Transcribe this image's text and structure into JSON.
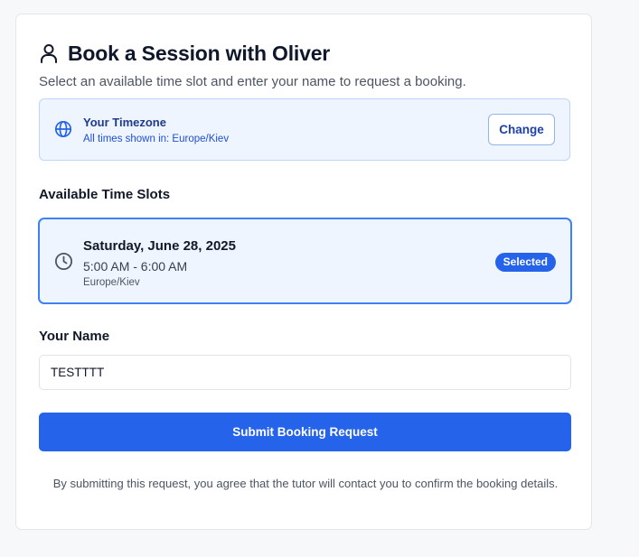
{
  "header": {
    "icon": "user-icon",
    "title": "Book a Session with Oliver",
    "subtitle": "Select an available time slot and enter your name to request a booking."
  },
  "timezone": {
    "icon": "globe-icon",
    "label": "Your Timezone",
    "description": "All times shown in: Europe/Kiev",
    "change_label": "Change"
  },
  "slots": {
    "heading": "Available Time Slots",
    "items": [
      {
        "icon": "clock-icon",
        "date": "Saturday, June 28, 2025",
        "time": "5:00 AM - 6:00 AM",
        "timezone": "Europe/Kiev",
        "badge": "Selected",
        "selected": true
      }
    ]
  },
  "name_field": {
    "label": "Your Name",
    "value": "TESTTTT",
    "placeholder": ""
  },
  "submit": {
    "label": "Submit Booking Request"
  },
  "disclaimer": "By submitting this request, you agree that the tutor will contact you to confirm the booking details.",
  "colors": {
    "accent": "#2563eb",
    "info_background": "#eff5ff",
    "info_border": "#bfd5f7",
    "selected_border": "#3b82f6"
  }
}
